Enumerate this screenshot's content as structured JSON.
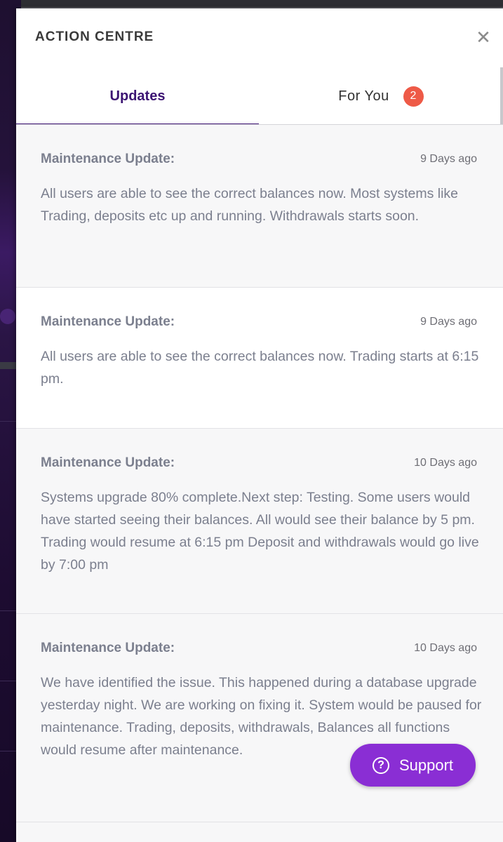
{
  "panel": {
    "title": "ACTION CENTRE",
    "close_icon": "close-icon"
  },
  "tabs": [
    {
      "label": "Updates",
      "active": true
    },
    {
      "label": "For You",
      "badge": "2",
      "active": false
    }
  ],
  "updates": [
    {
      "title": "Maintenance Update:",
      "time": "9 Days ago",
      "body": "All users are able to see the correct balances now. Most systems like Trading, deposits etc up and running. Withdrawals starts soon."
    },
    {
      "title": "Maintenance Update:",
      "time": "9 Days ago",
      "body": "All users are able to see the correct balances now. Trading starts at 6:15 pm."
    },
    {
      "title": "Maintenance Update:",
      "time": "10 Days ago",
      "body": "Systems upgrade 80% complete.Next step: Testing. Some users would have started seeing their balances. All would see their balance by 5 pm. Trading would resume at 6:15 pm Deposit and withdrawals would go live by 7:00 pm"
    },
    {
      "title": "Maintenance Update:",
      "time": "10 Days ago",
      "body": "We have identified the issue. This happened during a database upgrade yesterday night. We are working on fixing it. System would be paused for maintenance. Trading, deposits, withdrawals, Balances all functions would resume after maintenance."
    }
  ],
  "support": {
    "label": "Support",
    "icon": "question-circle-icon"
  },
  "colors": {
    "accent": "#3c1473",
    "badge": "#ee5a47",
    "support": "#8a2ed4",
    "text_muted": "#7b7f8e"
  }
}
